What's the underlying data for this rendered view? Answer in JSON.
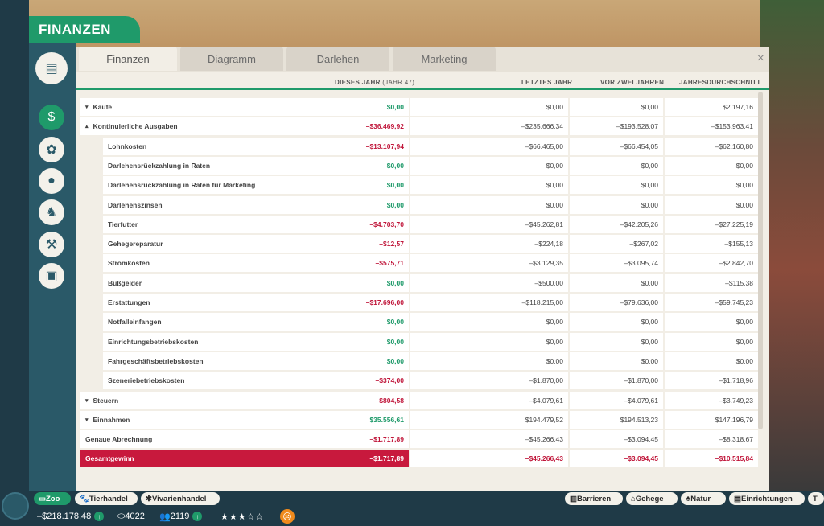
{
  "app_title": "FINANZEN",
  "tabs": [
    {
      "label": "Finanzen"
    },
    {
      "label": "Diagramm"
    },
    {
      "label": "Darlehen"
    },
    {
      "label": "Marketing"
    }
  ],
  "close_icon": "×",
  "headers": {
    "this_year": "DIESES JAHR",
    "this_year_sub": "(JAHR 47)",
    "last_year": "LETZTES JAHR",
    "two_years": "VOR ZWEI JAHREN",
    "avg": "JAHRESDURCHSCHNITT"
  },
  "rows": [
    {
      "label": "Käufe",
      "arrow": "▾",
      "indent": 0,
      "c1": "$0,00",
      "c2": "$0,00",
      "c3": "$0,00",
      "c4": "$2.197,16",
      "s1": "pos"
    },
    {
      "label": "Kontinuierliche Ausgaben",
      "arrow": "▴",
      "indent": 0,
      "c1": "–$36.469,92",
      "c2": "–$235.666,34",
      "c3": "–$193.528,07",
      "c4": "–$153.963,41",
      "s1": "neg"
    },
    {
      "label": "Lohnkosten",
      "arrow": "",
      "indent": 1,
      "c1": "–$13.107,94",
      "c2": "–$66.465,00",
      "c3": "–$66.454,05",
      "c4": "–$62.160,80",
      "s1": "neg"
    },
    {
      "label": "Darlehensrückzahlung in Raten",
      "arrow": "",
      "indent": 1,
      "c1": "$0,00",
      "c2": "$0,00",
      "c3": "$0,00",
      "c4": "$0,00",
      "s1": "pos"
    },
    {
      "label": "Darlehensrückzahlung in Raten für Marketing",
      "arrow": "",
      "indent": 1,
      "c1": "$0,00",
      "c2": "$0,00",
      "c3": "$0,00",
      "c4": "$0,00",
      "s1": "pos"
    },
    {
      "label": "Darlehenszinsen",
      "arrow": "",
      "indent": 1,
      "c1": "$0,00",
      "c2": "$0,00",
      "c3": "$0,00",
      "c4": "$0,00",
      "s1": "pos"
    },
    {
      "label": "Tierfutter",
      "arrow": "",
      "indent": 1,
      "c1": "–$4.703,70",
      "c2": "–$45.262,81",
      "c3": "–$42.205,26",
      "c4": "–$27.225,19",
      "s1": "neg"
    },
    {
      "label": "Gehegereparatur",
      "arrow": "",
      "indent": 1,
      "c1": "–$12,57",
      "c2": "–$224,18",
      "c3": "–$267,02",
      "c4": "–$155,13",
      "s1": "neg"
    },
    {
      "label": "Stromkosten",
      "arrow": "",
      "indent": 1,
      "c1": "–$575,71",
      "c2": "–$3.129,35",
      "c3": "–$3.095,74",
      "c4": "–$2.842,70",
      "s1": "neg"
    },
    {
      "label": "Bußgelder",
      "arrow": "",
      "indent": 1,
      "c1": "$0,00",
      "c2": "–$500,00",
      "c3": "$0,00",
      "c4": "–$115,38",
      "s1": "pos"
    },
    {
      "label": "Erstattungen",
      "arrow": "",
      "indent": 1,
      "c1": "–$17.696,00",
      "c2": "–$118.215,00",
      "c3": "–$79.636,00",
      "c4": "–$59.745,23",
      "s1": "neg"
    },
    {
      "label": "Notfalleinfangen",
      "arrow": "",
      "indent": 1,
      "c1": "$0,00",
      "c2": "$0,00",
      "c3": "$0,00",
      "c4": "$0,00",
      "s1": "pos"
    },
    {
      "label": "Einrichtungsbetriebskosten",
      "arrow": "",
      "indent": 1,
      "c1": "$0,00",
      "c2": "$0,00",
      "c3": "$0,00",
      "c4": "$0,00",
      "s1": "pos"
    },
    {
      "label": "Fahrgeschäftsbetriebskosten",
      "arrow": "",
      "indent": 1,
      "c1": "$0,00",
      "c2": "$0,00",
      "c3": "$0,00",
      "c4": "$0,00",
      "s1": "pos"
    },
    {
      "label": "Szeneriebetriebskosten",
      "arrow": "",
      "indent": 1,
      "c1": "–$374,00",
      "c2": "–$1.870,00",
      "c3": "–$1.870,00",
      "c4": "–$1.718,96",
      "s1": "neg"
    },
    {
      "label": "Steuern",
      "arrow": "▾",
      "indent": 0,
      "c1": "–$804,58",
      "c2": "–$4.079,61",
      "c3": "–$4.079,61",
      "c4": "–$3.749,23",
      "s1": "neg"
    },
    {
      "label": "Einnahmen",
      "arrow": "▾",
      "indent": 0,
      "c1": "$35.556,61",
      "c2": "$194.479,52",
      "c3": "$194.513,23",
      "c4": "$147.196,79",
      "s1": "pos"
    },
    {
      "label": "Genaue Abrechnung",
      "arrow": "",
      "indent": 0,
      "c1": "–$1.717,89",
      "c2": "–$45.266,43",
      "c3": "–$3.094,45",
      "c4": "–$8.318,67",
      "s1": "neg"
    },
    {
      "label": "Gesamtgewinn",
      "arrow": "",
      "indent": 0,
      "c1": "–$1.717,89",
      "c2": "–$45.266,43",
      "c3": "–$3.094,45",
      "c4": "–$10.515,84",
      "s1": "neg",
      "total": true
    }
  ],
  "bottom": {
    "zoo": "Zoo",
    "tierhandel": "Tierhandel",
    "vivarien": "Vivarienhandel",
    "barrieren": "Barrieren",
    "gehege": "Gehege",
    "natur": "Natur",
    "einrichtungen": "Einrichtungen",
    "money": "–$218.178,48",
    "tickets": "4022",
    "guests": "2119",
    "rating_stars": 3.5
  }
}
